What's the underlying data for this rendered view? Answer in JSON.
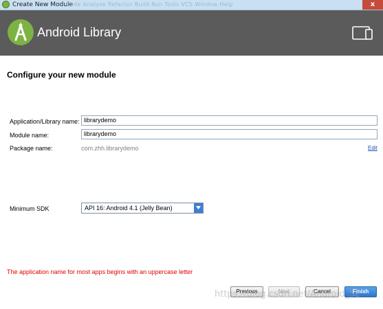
{
  "window": {
    "title": "Create New Module",
    "menu_hint": "Code  Analyze  Refactor  Build  Run  Tools  VCS  Window  Help",
    "close_glyph": "x"
  },
  "banner": {
    "title": "Android Library",
    "background": "#5b5b5b",
    "logo_icon": "android-studio-logo-icon",
    "device_icon": "device-tablet-icon"
  },
  "page": {
    "heading": "Configure your new module"
  },
  "form": {
    "app_name_label": "Application/Library name:",
    "app_name_value": "librarydemo",
    "module_name_label": "Module name:",
    "module_name_value": "librarydemo",
    "package_label": "Package name:",
    "package_value": "com.zhh.librarydemo",
    "edit_link": "Edit",
    "min_sdk_label": "Minimum SDK",
    "min_sdk_value": "API 16: Android 4.1 (Jelly Bean)"
  },
  "validation": {
    "message": "The application name for most apps begins with an uppercase letter",
    "color": "#e00000"
  },
  "buttons": {
    "previous": "Previous",
    "next": "Next",
    "cancel": "Cancel",
    "finish": "Finish"
  },
  "watermark": "https://blog.csdn.net/Android_SE"
}
